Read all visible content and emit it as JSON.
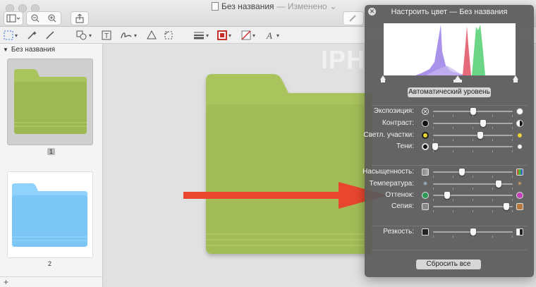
{
  "window": {
    "title": "Без названия",
    "edited": "— Изменено"
  },
  "sidebar": {
    "header": "Без названия",
    "pages": [
      {
        "number": "1",
        "folder_color": "#a9c35d",
        "selected": true
      },
      {
        "number": "2",
        "folder_color": "#7cc6f5",
        "selected": false
      }
    ],
    "add_label": "+"
  },
  "watermark": "IPHONES",
  "panel": {
    "title": "Настроить цвет — Без названия",
    "auto_level_label": "Автоматический уровень",
    "reset_label": "Сбросить все",
    "sliders": [
      {
        "label": "Экспозиция:",
        "value": 0.5
      },
      {
        "label": "Контраст:",
        "value": 0.63
      },
      {
        "label": "Светл. участки:",
        "value": 0.59
      },
      {
        "label": "Тени:",
        "value": 0.03
      },
      {
        "label": "Насыщенность:",
        "value": 0.36
      },
      {
        "label": "Температура:",
        "value": 0.82
      },
      {
        "label": "Оттенок:",
        "value": 0.18
      },
      {
        "label": "Сепия:",
        "value": 0.92
      },
      {
        "label": "Резкость:",
        "value": 0.5
      }
    ]
  },
  "colors": {
    "document_folder": "#a9c35d",
    "arrow": "#e8462f"
  }
}
